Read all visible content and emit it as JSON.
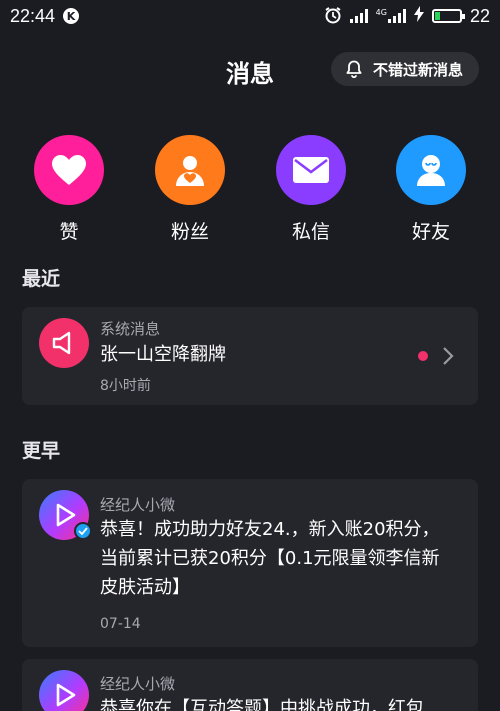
{
  "status_bar": {
    "time": "22:44",
    "app_badge": "K",
    "network_label": "4G",
    "battery_level": "22",
    "battery_fraction": 0.22
  },
  "header": {
    "title": "消息",
    "notify_button_label": "不错过新消息"
  },
  "quick_entries": [
    {
      "label": "赞",
      "color": "#ff1f9a",
      "icon": "heart-icon"
    },
    {
      "label": "粉丝",
      "color": "#ff7a1a",
      "icon": "fan-user-icon"
    },
    {
      "label": "私信",
      "color": "#8a3cff",
      "icon": "mail-icon"
    },
    {
      "label": "好友",
      "color": "#1f9bff",
      "icon": "friend-icon"
    }
  ],
  "recent": {
    "section_title": "最近",
    "item": {
      "sender": "系统消息",
      "message": "张一山空降翻牌",
      "time": "8小时前",
      "unread": true,
      "icon": "speaker-icon"
    }
  },
  "earlier": {
    "section_title": "更早",
    "items": [
      {
        "sender": "经纪人小微",
        "message_lines": [
          "恭喜！成功助力好友24.，新入账20积分，",
          "当前累计已获20积分【0.1元限量领李信新",
          "皮肤活动】"
        ],
        "time": "07-14"
      },
      {
        "sender": "经纪人小微",
        "message_lines": [
          "恭喜你在【互动答题】中挑战成功，红包"
        ],
        "time": ""
      }
    ]
  }
}
